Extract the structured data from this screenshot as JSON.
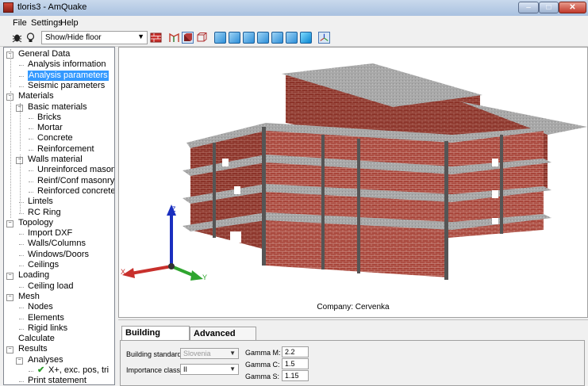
{
  "window": {
    "title": "tloris3 - AmQuake"
  },
  "menu": [
    "File",
    "Settings",
    "Help"
  ],
  "toolbar": {
    "floor_combo": "Show/Hide floor"
  },
  "tree": [
    {
      "label": "General Data",
      "level": 0,
      "exp": "-"
    },
    {
      "label": "Analysis information",
      "level": 1
    },
    {
      "label": "Analysis parameters",
      "level": 1,
      "selected": true
    },
    {
      "label": "Seismic parameters",
      "level": 1
    },
    {
      "label": "Materials",
      "level": 0,
      "exp": "-"
    },
    {
      "label": "Basic materials",
      "level": 1,
      "exp": "-"
    },
    {
      "label": "Bricks",
      "level": 2
    },
    {
      "label": "Mortar",
      "level": 2
    },
    {
      "label": "Concrete",
      "level": 2
    },
    {
      "label": "Reinforcement",
      "level": 2
    },
    {
      "label": "Walls material",
      "level": 1,
      "exp": "-"
    },
    {
      "label": "Unreinforced masonry",
      "level": 2
    },
    {
      "label": "Reinf/Conf masonry",
      "level": 2
    },
    {
      "label": "Reinforced concrete",
      "level": 2
    },
    {
      "label": "Lintels",
      "level": 1
    },
    {
      "label": "RC Ring",
      "level": 1
    },
    {
      "label": "Topology",
      "level": 0,
      "exp": "-"
    },
    {
      "label": "Import DXF",
      "level": 1
    },
    {
      "label": "Walls/Columns",
      "level": 1
    },
    {
      "label": "Windows/Doors",
      "level": 1
    },
    {
      "label": "Ceilings",
      "level": 1
    },
    {
      "label": "Loading",
      "level": 0,
      "exp": "-"
    },
    {
      "label": "Ceiling load",
      "level": 1
    },
    {
      "label": "Mesh",
      "level": 0,
      "exp": "-"
    },
    {
      "label": "Nodes",
      "level": 1
    },
    {
      "label": "Elements",
      "level": 1
    },
    {
      "label": "Rigid links",
      "level": 1
    },
    {
      "label": "Calculate",
      "level": 0
    },
    {
      "label": "Results",
      "level": 0,
      "exp": "-"
    },
    {
      "label": "Analyses",
      "level": 1,
      "exp": "-"
    },
    {
      "label": "X+, exc. pos, tri",
      "level": 2,
      "check": true
    },
    {
      "label": "Print statement",
      "level": 1
    }
  ],
  "viewport": {
    "company": "Company: Cervenka",
    "axes": {
      "x": "X",
      "y": "Y",
      "z": "Z"
    }
  },
  "tabs": [
    "Building standard",
    "Advanced settings"
  ],
  "form": {
    "building_standard_label": "Building standard:",
    "building_standard_value": "Slovenia",
    "importance_class_label": "Importance class:",
    "importance_class_value": "II",
    "gamma_m_label": "Gamma M:",
    "gamma_m_value": "2.2",
    "gamma_c_label": "Gamma C:",
    "gamma_c_value": "1.5",
    "gamma_s_label": "Gamma S:",
    "gamma_s_value": "1.15"
  },
  "colors": {
    "brick": "#a8453a",
    "slab": "#a3a3a3",
    "selection": "#3399ff"
  }
}
